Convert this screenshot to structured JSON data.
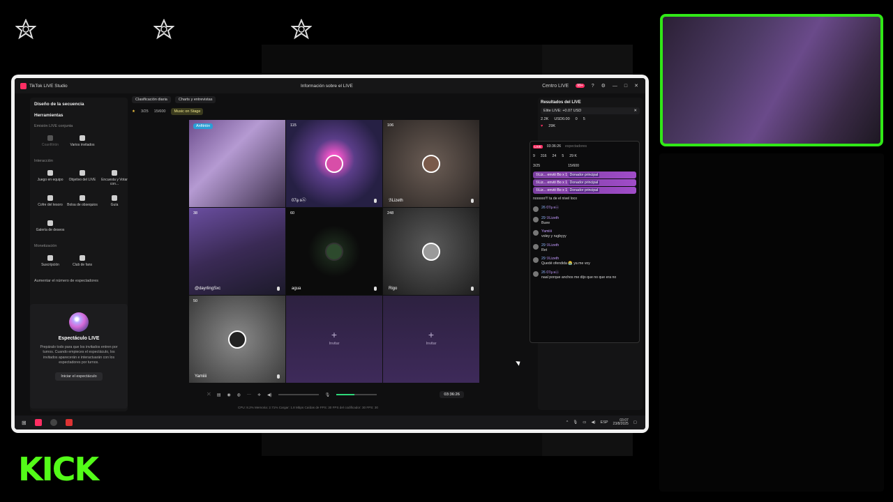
{
  "overlay": {
    "icons": [
      "star-badge-icon",
      "star-badge-icon",
      "star-badge-icon"
    ],
    "logo": "KICK",
    "logo_color": "#53fc18",
    "cam_border_color": "#31e817"
  },
  "window": {
    "app_title": "TikTok LIVE Studio",
    "center_title": "Información sobre el LIVE",
    "live_center": "Centro LIVE",
    "notif_badge": "99+"
  },
  "sidebar": {
    "scene_design": "Diseño de la secuencia",
    "tools_title": "Herramientas",
    "sec_joint": "Emisión LIVE conjunta",
    "joint_tools": [
      "Coanfitrión",
      "Varios invitados"
    ],
    "sec_interaction": "Interacción",
    "interaction_tools": [
      "Juego en equipo",
      "Objetivo del LIVE",
      "Encuesta y Votar con...",
      "Cofre del tesoro",
      "Bolsa de obsequios",
      "Guía",
      "Galería de deseos"
    ],
    "sec_monetization": "Monetización",
    "monetization_tools": [
      "Suscripción",
      "Club de fans"
    ],
    "increase_viewers": "Aumentar el número de espectadores",
    "show": {
      "title": "Espectáculo LIVE",
      "desc": "Prepáralo todo para que los invitados entren por turnos. Cuando empieces el espectáculo, los invitados aparecerán e interactuarán con los espectadores por turnos.",
      "button": "Iniciar el espectáculo"
    }
  },
  "center": {
    "tabs": [
      "Clasificación diaria",
      "Charts y entrevistas"
    ],
    "stat_left": "3/25",
    "stat_mid": "15/600",
    "music": "Music on Stage"
  },
  "tiles": [
    {
      "tag": "Anfitrión",
      "count": "",
      "name": ""
    },
    {
      "tag": "",
      "count": "115",
      "name": "07ḁ ᵴ㉦"
    },
    {
      "tag": "",
      "count": "106",
      "name": "ℬLizeth"
    },
    {
      "tag": "",
      "count": "38",
      "name": "@dayrlingSxc"
    },
    {
      "tag": "",
      "count": "60",
      "name": "agua"
    },
    {
      "tag": "",
      "count": "248",
      "name": "Rigo"
    },
    {
      "tag": "",
      "count": "50",
      "name": "Yamiiii"
    }
  ],
  "invite_label": "Invitar",
  "controls": {
    "timer": "03:36:26"
  },
  "status_line": "CPU: 8.2%   Memoria: 2.71%   Cargar: 1.8 Mbps   Caídas de FPS: 30   FPS del codificador: 30   FPS: 30",
  "results": {
    "title": "Resultados del LIVE",
    "elite": "Elite LIVE: +0.07 USD",
    "kpis": [
      "2.2K",
      "USD0.00",
      "0",
      "5"
    ],
    "likes": "29K"
  },
  "chat": {
    "live_tag": "LIVE",
    "timer": "03:36:26",
    "viewers_label": "espectadores",
    "row1": [
      "9",
      "316",
      "24",
      "5",
      "29 K"
    ],
    "mini": [
      "3/25",
      "15/600"
    ],
    "gifts": [
      {
        "user": "ℬLiz...",
        "text": "envió Bo",
        "x": "x 1",
        "tag": "Donador principal"
      },
      {
        "user": "ℬLiz...",
        "text": "envió Bo",
        "x": "x 1",
        "tag": "Donador principal"
      },
      {
        "user": "ℬLiz...",
        "text": "envió Bo",
        "x": "x 1",
        "tag": "Donador principal"
      }
    ],
    "messages": [
      {
        "lvl": "",
        "user": "",
        "text": "nooooo!!! ta de el nivel loco"
      },
      {
        "lvl": "26",
        "user": "07ḁ ᵴ㉦",
        "text": ""
      },
      {
        "lvl": "29",
        "user": "ℬLizeth",
        "text": "Buee"
      },
      {
        "lvl": "",
        "user": "Yamiiii",
        "text": "voley y rugbyyy"
      },
      {
        "lvl": "29",
        "user": "ℬLizeth",
        "text": "Ret"
      },
      {
        "lvl": "29",
        "user": "ℬLizeth",
        "text": "Quedé ofendida 😭 ya me voy"
      },
      {
        "lvl": "26",
        "user": "07ḁ ᵴ㉦",
        "text": "naal porque anchos me dijo que no que era no"
      }
    ]
  },
  "taskbar": {
    "lang": "ESP",
    "time": "03:07",
    "date": "23/8/2025"
  }
}
